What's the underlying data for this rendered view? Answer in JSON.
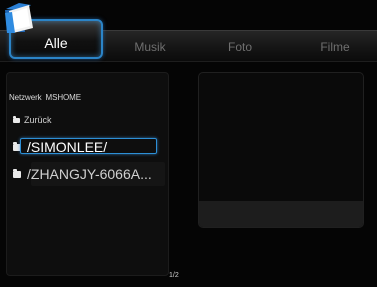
{
  "tabs": [
    {
      "label": "Alle",
      "active": true
    },
    {
      "label": "Musik",
      "active": false
    },
    {
      "label": "Foto",
      "active": false
    },
    {
      "label": "Filme",
      "active": false
    }
  ],
  "breadcrumb": {
    "network": "Netzwerk",
    "group": "MSHOME"
  },
  "list": {
    "back_label": "Zurück",
    "items": [
      {
        "label": "/SIMONLEE/",
        "selected": true
      },
      {
        "label": "/ZHANGJY-6066A...",
        "selected": false
      }
    ]
  },
  "pagination": {
    "text": "1/2"
  },
  "icons": {
    "logo": "folder-icon",
    "item": "folder-icon"
  },
  "colors": {
    "accent": "#2b84c7",
    "background": "#050505",
    "tab_inactive": "#6f6f6f"
  }
}
